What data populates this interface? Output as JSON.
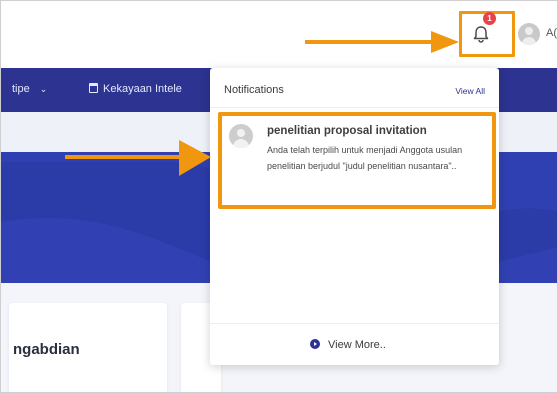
{
  "header": {
    "notification_count": "1",
    "user_abbr": "A("
  },
  "nav": {
    "items": [
      {
        "label": "tipe",
        "icon": "chevron-down-icon"
      },
      {
        "label": "Kekayaan Intele",
        "icon": "document-icon"
      }
    ]
  },
  "notifications": {
    "title": "Notifications",
    "view_all": "View All",
    "items": [
      {
        "title": "penelitian proposal invitation",
        "body": "Anda telah terpilih untuk menjadi Anggota usulan penelitian berjudul \"judul penelitian nusantara\".."
      }
    ],
    "view_more": "View More.."
  },
  "main": {
    "card_title": "ngabdian"
  },
  "colors": {
    "navy": "#2c3390",
    "hero": "#2b3ba8",
    "highlight": "#f0960f",
    "badge": "#e8434a"
  }
}
